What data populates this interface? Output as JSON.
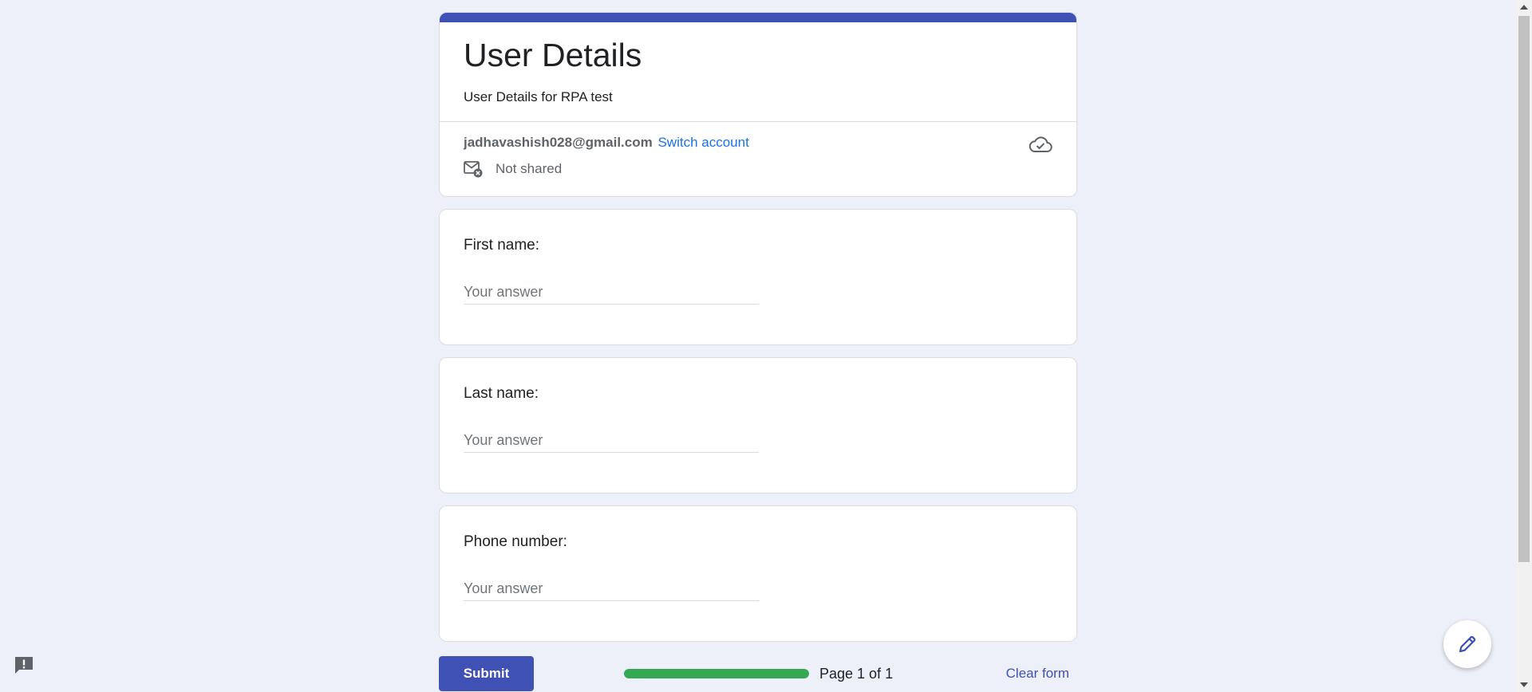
{
  "form": {
    "title": "User Details",
    "description": "User Details for RPA test",
    "account_email": "jadhavashish028@gmail.com",
    "switch_account_label": "Switch account",
    "not_shared_label": "Not shared"
  },
  "questions": [
    {
      "label": "First name:",
      "placeholder": "Your answer",
      "value": ""
    },
    {
      "label": "Last name:",
      "placeholder": "Your answer",
      "value": ""
    },
    {
      "label": "Phone number:",
      "placeholder": "Your answer",
      "value": ""
    }
  ],
  "footer": {
    "submit_label": "Submit",
    "progress_percent": 100,
    "page_indicator": "Page 1 of 1",
    "clear_form_label": "Clear form"
  },
  "colors": {
    "accent": "#3f51b5",
    "link": "#1a73e8",
    "progress": "#34a853",
    "background": "#eef0f9"
  },
  "icons": {
    "cloud_saved": "cloud-check-icon",
    "mail_not_shared": "mail-x-icon",
    "feedback": "feedback-exclamation-icon",
    "edit": "pencil-icon"
  }
}
